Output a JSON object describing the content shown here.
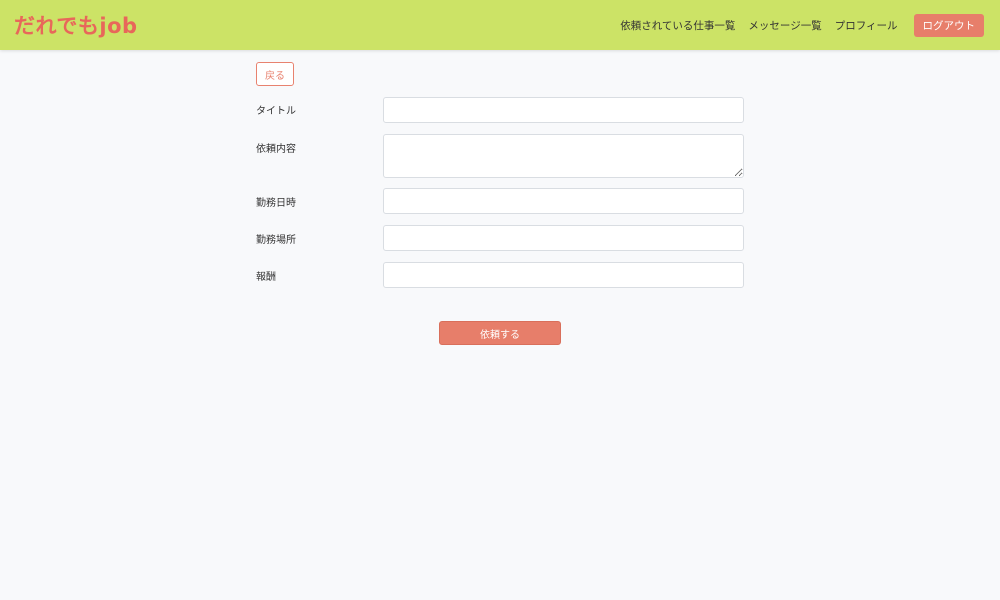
{
  "header": {
    "brand": "だれでもjob",
    "nav": {
      "requested_jobs": "依頼されている仕事一覧",
      "messages": "メッセージ一覧",
      "profile": "プロフィール",
      "logout": "ログアウト"
    }
  },
  "form": {
    "back_label": "戻る",
    "title_label": "タイトル",
    "title_value": "",
    "content_label": "依頼内容",
    "content_value": "",
    "datetime_label": "勤務日時",
    "datetime_value": "",
    "location_label": "勤務場所",
    "location_value": "",
    "reward_label": "報酬",
    "reward_value": "",
    "submit_label": "依頼する"
  },
  "colors": {
    "navbar": "#cce366",
    "brand": "#e8675a",
    "accent": "#e77e6a",
    "background": "#f8f9fb"
  }
}
